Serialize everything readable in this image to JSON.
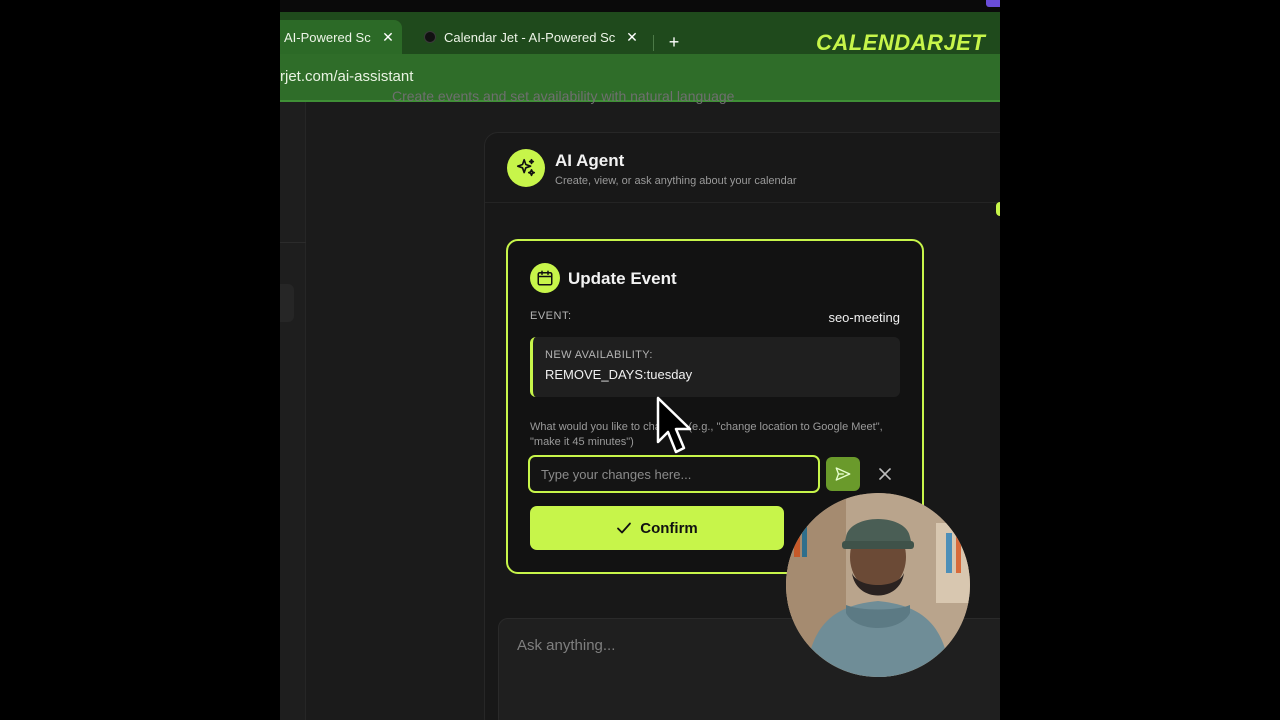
{
  "browser": {
    "tabs": [
      {
        "title": "AI-Powered Sc",
        "close": "✕",
        "active": true
      },
      {
        "title": "Calendar Jet - AI-Powered Sc",
        "close": "✕",
        "active": false
      }
    ],
    "new_tab": "+",
    "url": "rjet.com/ai-assistant",
    "brand": "CALENDARJET"
  },
  "page": {
    "subtitle": "Create events and set availability with natural language"
  },
  "agent": {
    "title": "AI Agent",
    "subtitle": "Create, view, or ask anything about your calendar"
  },
  "card": {
    "title": "Update Event",
    "event_label": "EVENT:",
    "event_value": "seo-meeting",
    "availability_label": "NEW AVAILABILITY:",
    "availability_value": "REMOVE_DAYS:tuesday",
    "help_text": "What would you like to change? (e.g., \"change location to Google Meet\", \"make it 45 minutes\")",
    "input_placeholder": "Type your changes here...",
    "confirm_label": "Confirm"
  },
  "chat": {
    "placeholder": "Ask anything..."
  },
  "colors": {
    "accent": "#c7f54a",
    "browser_green": "#2f6d29",
    "panel_bg": "#181818"
  },
  "icons": {
    "agent": "sparkles-icon",
    "card": "calendar-icon",
    "send": "send-icon",
    "close": "close-icon",
    "confirm": "check-icon"
  }
}
